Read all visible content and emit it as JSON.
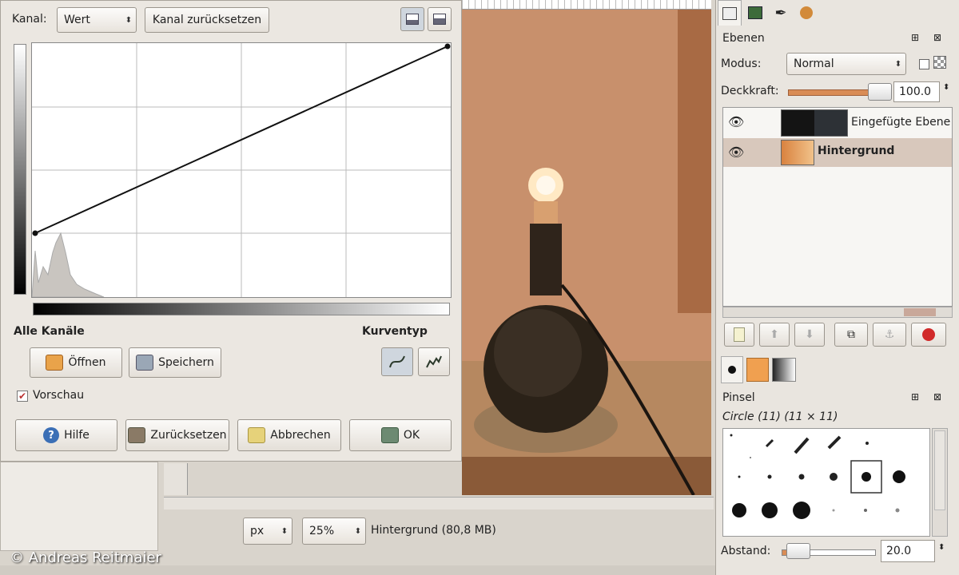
{
  "curves": {
    "kanal_label": "Kanal:",
    "kanal_value": "Wert",
    "reset_channel": "Kanal zurücksetzen",
    "alle_kanaele": "Alle Kanäle",
    "kurventyp": "Kurventyp",
    "open": "Öffnen",
    "save": "Speichern",
    "preview": "Vorschau",
    "help": "Hilfe",
    "reset": "Zurücksetzen",
    "cancel": "Abbrechen",
    "ok": "OK"
  },
  "image_window": {
    "unit": "px",
    "zoom": "25%",
    "status": "Hintergrund (80,8 MB)"
  },
  "layers": {
    "title": "Ebenen",
    "mode_label": "Modus:",
    "mode_value": "Normal",
    "opacity_label": "Deckkraft:",
    "opacity_value": "100.0",
    "items": [
      {
        "name": "Eingefügte Ebene"
      },
      {
        "name": "Hintergrund"
      }
    ]
  },
  "brushes": {
    "title": "Pinsel",
    "current": "Circle (11) (11 × 11)",
    "spacing_label": "Abstand:",
    "spacing_value": "20.0"
  },
  "credit": "© Andreas Reitmaier",
  "colors": {
    "accent": "#c46a2f",
    "selection": "#d8c8bc",
    "dialog_bg": "#ebe7e1"
  }
}
